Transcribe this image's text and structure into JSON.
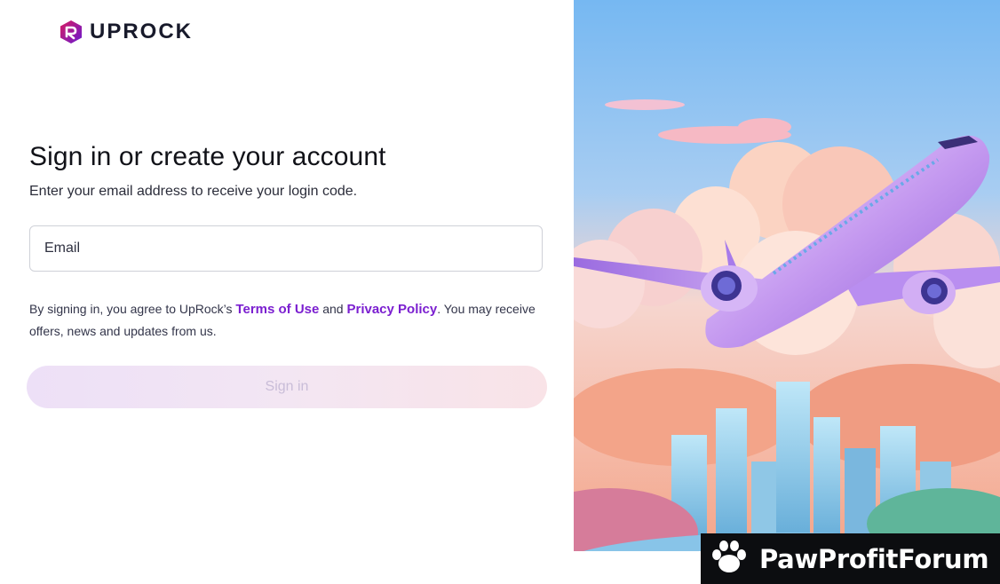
{
  "brand": {
    "name": "UPROCK",
    "logo_icon": "uprock-hexagon-logo",
    "colors": {
      "accent": "#7b1fd0",
      "logo_gradient_start": "#c2185b",
      "logo_gradient_end": "#6a1bd1"
    }
  },
  "form": {
    "title": "Sign in or create your account",
    "subtitle": "Enter your email address to receive your login code.",
    "email_placeholder": "Email",
    "email_value": "",
    "terms_prefix": "By signing in, you agree to UpRock’s ",
    "terms_link": "Terms of Use",
    "terms_middle": " and ",
    "privacy_link": "Privacy Policy",
    "terms_suffix": ". You may receive offers, news and updates from us.",
    "submit_label": "Sign in",
    "submit_disabled": true
  },
  "illustration": {
    "icon": "airplane-over-city-illustration"
  },
  "watermark": {
    "text": "PawProfitForum",
    "icon": "paw-icon"
  }
}
